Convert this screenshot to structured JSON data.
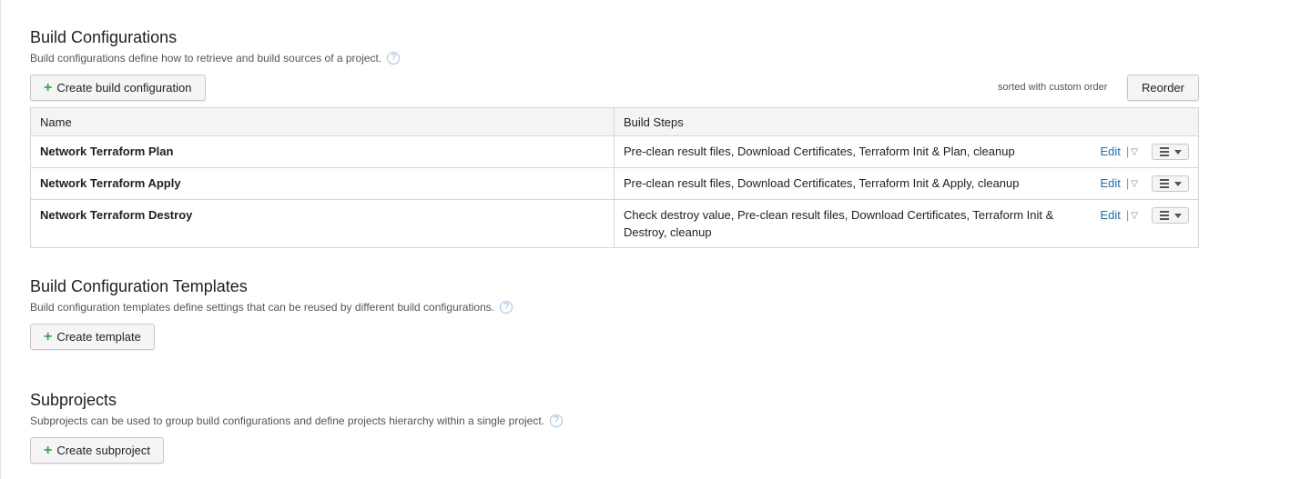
{
  "build_configs": {
    "title": "Build Configurations",
    "description": "Build configurations define how to retrieve and build sources of a project.",
    "create_label": "Create build configuration",
    "sort_note": "sorted with custom order",
    "reorder_label": "Reorder",
    "columns": [
      "Name",
      "Build Steps"
    ],
    "rows": [
      {
        "name": "Network Terraform Plan",
        "steps": "Pre-clean result files, Download Certificates, Terraform Init & Plan, cleanup",
        "edit": "Edit"
      },
      {
        "name": "Network Terraform Apply",
        "steps": "Pre-clean result files, Download Certificates, Terraform Init & Apply, cleanup",
        "edit": "Edit"
      },
      {
        "name": "Network Terraform Destroy",
        "steps": "Check destroy value, Pre-clean result files, Download Certificates, Terraform Init & Destroy, cleanup",
        "edit": "Edit"
      }
    ]
  },
  "templates": {
    "title": "Build Configuration Templates",
    "description": "Build configuration templates define settings that can be reused by different build configurations.",
    "create_label": "Create template"
  },
  "subprojects": {
    "title": "Subprojects",
    "description": "Subprojects can be used to group build configurations and define projects hierarchy within a single project.",
    "create_label": "Create subproject"
  },
  "icons": {
    "help": "question-circle-icon",
    "plus": "plus-icon",
    "dropdown": "triangle-down-icon",
    "menu": "list-menu-icon"
  },
  "colors": {
    "link": "#1a6fb8",
    "plus": "#3aa34a",
    "help": "#7eb0dd"
  }
}
